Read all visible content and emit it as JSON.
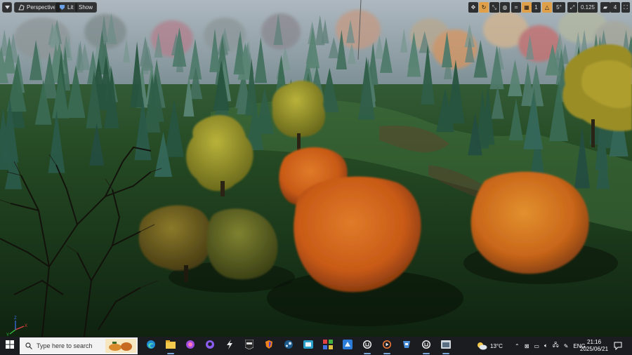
{
  "viewport": {
    "mode_label": "Perspective",
    "lit_label": "Lit",
    "show_label": "Show",
    "menu_icon": "chevron-down-icon",
    "snap_angle": "5°",
    "grid_size": "1",
    "scale_value": "0.125",
    "camera_speed": "4"
  },
  "taskbar": {
    "search_placeholder": "Type here to search",
    "weather_temp": "13°C",
    "language": "ENG",
    "time": "21:16",
    "date": "2025/06/21",
    "apps": [
      "edge-icon",
      "file-explorer-icon",
      "messenger-icon",
      "github-icon",
      "tool-icon",
      "epic-games-icon",
      "browser-icon",
      "steam-icon",
      "app-icon",
      "app-grid-icon",
      "store-icon",
      "unreal-engine-icon",
      "media-player-icon",
      "editor-icon",
      "unreal-engine-2-icon",
      "app-window-icon"
    ],
    "accent": "#7aa7d8"
  }
}
